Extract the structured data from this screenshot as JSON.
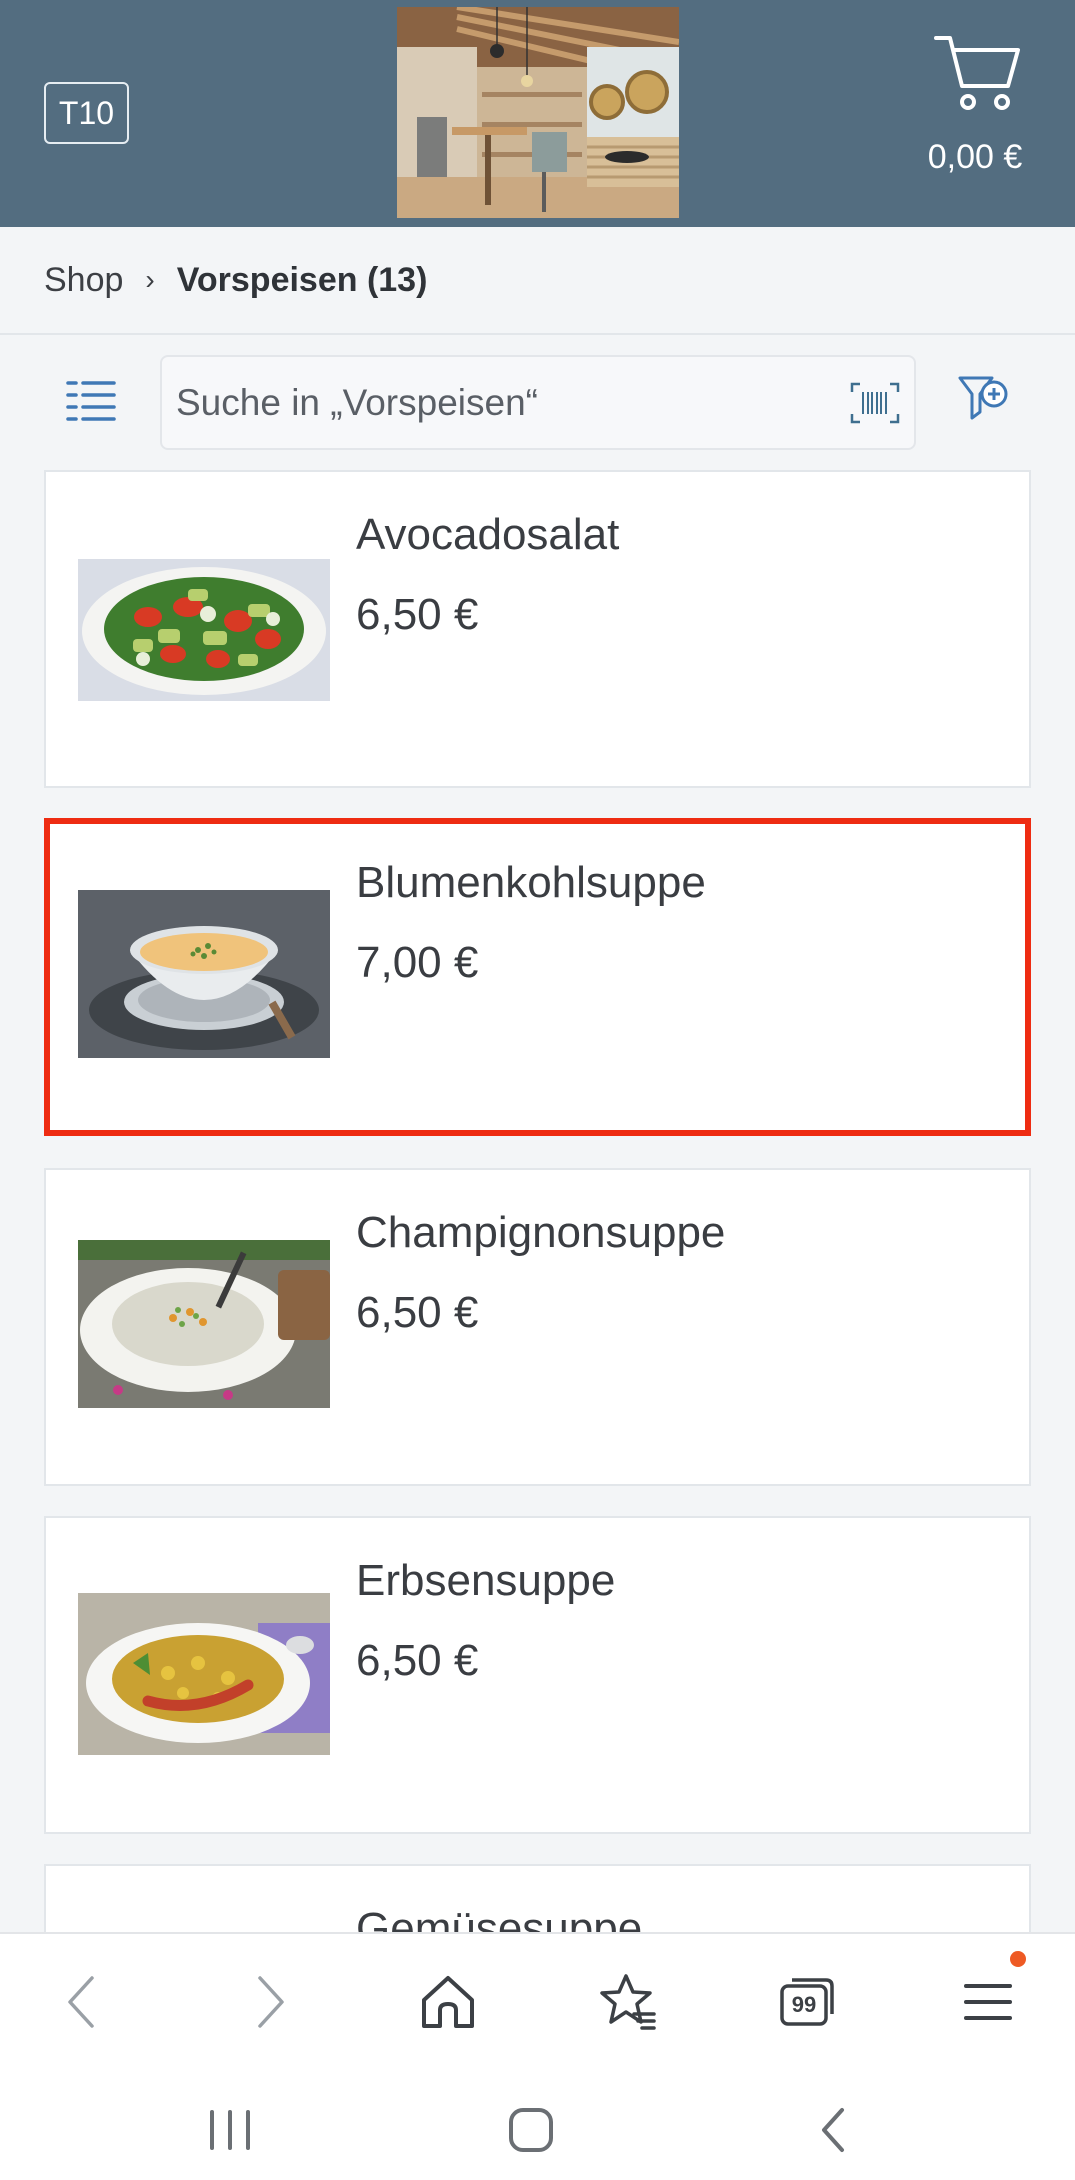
{
  "header": {
    "table_label": "T10",
    "cart_total": "0,00 €",
    "colors": {
      "background": "#536d80",
      "text": "#ffffff"
    }
  },
  "breadcrumb": {
    "root": "Shop",
    "separator": "›",
    "current": "Vorspeisen (13)"
  },
  "toolbar": {
    "search_placeholder": "Suche in „Vorspeisen“",
    "icons": [
      "list-view-icon",
      "barcode-scan-icon",
      "filter-add-icon"
    ]
  },
  "products": [
    {
      "name": "Avocadosalat",
      "price": "6,50 €",
      "image": "avocado-salad-photo"
    },
    {
      "name": "Blumenkohlsuppe",
      "price": "7,00 €",
      "image": "cauliflower-soup-photo",
      "highlighted": true
    },
    {
      "name": "Champignonsuppe",
      "price": "6,50 €",
      "image": "mushroom-soup-photo"
    },
    {
      "name": "Erbsensuppe",
      "price": "6,50 €",
      "image": "pea-soup-photo"
    },
    {
      "name": "Gemüsesuppe",
      "price": "",
      "image": ""
    }
  ],
  "browser_nav": {
    "icons": [
      "back-arrow-icon",
      "forward-arrow-icon",
      "home-icon",
      "bookmarks-icon",
      "tabs-icon",
      "menu-icon"
    ],
    "tabs_count": "99",
    "notification_color": "#ee5a24"
  },
  "system_nav": {
    "icons": [
      "recent-apps-icon",
      "home-button-icon",
      "system-back-icon"
    ]
  },
  "colors": {
    "highlight": "#ee2c12",
    "accent": "#3f78b5"
  }
}
